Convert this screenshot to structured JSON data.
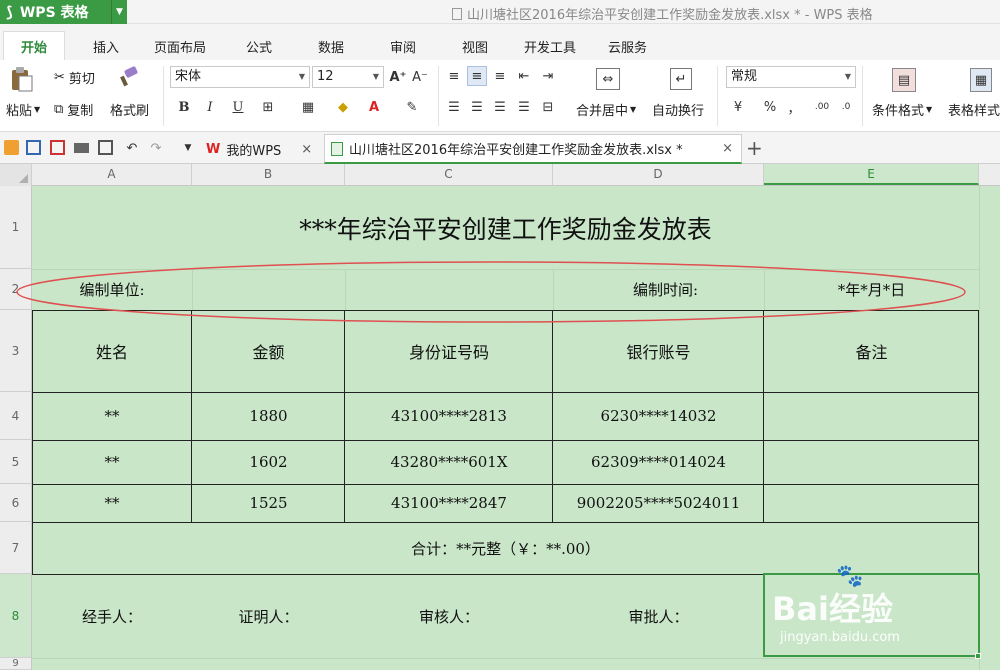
{
  "titlebar": {
    "app_button": "WPS 表格",
    "window_title": "山川塘社区2016年综治平安创建工作奖励金发放表.xlsx * - WPS 表格"
  },
  "menu_tabs": [
    "开始",
    "插入",
    "页面布局",
    "公式",
    "数据",
    "审阅",
    "视图",
    "开发工具",
    "云服务"
  ],
  "ribbon": {
    "paste": "粘贴",
    "cut": "剪切",
    "copy": "复制",
    "format_painter": "格式刷",
    "font_name": "宋体",
    "font_size": "12",
    "bold": "B",
    "italic": "I",
    "underline": "U",
    "merge_center": "合并居中",
    "wrap_text": "自动换行",
    "number_format": "常规",
    "percent": "%",
    "comma": "，",
    "cond_format": "条件格式",
    "table_style": "表格样式"
  },
  "doc_tabs": {
    "home_tab": "我的WPS",
    "file_tab": "山川塘社区2016年综治平安创建工作奖励金发放表.xlsx *"
  },
  "columns": [
    "A",
    "B",
    "C",
    "D",
    "E"
  ],
  "rows": [
    "1",
    "2",
    "3",
    "4",
    "5",
    "6",
    "7",
    "8",
    "9"
  ],
  "sheet": {
    "title": "***年综治平安创建工作奖励金发放表",
    "unit_label": "编制单位:",
    "time_label": "编制时间:",
    "time_value": "*年*月*日",
    "headers": [
      "姓名",
      "金额",
      "身份证号码",
      "银行账号",
      "备注"
    ],
    "records": [
      [
        "**",
        "1880",
        "43100****2813",
        "6230****14032",
        ""
      ],
      [
        "**",
        "1602",
        "43280****601X",
        "62309****014024",
        ""
      ],
      [
        "**",
        "1525",
        "43100****2847",
        "9002205****5024011",
        ""
      ]
    ],
    "total": "合计：**元整（￥：**.00）",
    "signatures": [
      "经手人：",
      "证明人：",
      "审核人：",
      "审批人："
    ]
  },
  "watermark": {
    "brand": "Bai经验",
    "url": "jingyan.baidu.com"
  },
  "colors": {
    "accent": "#3b9b45",
    "sheet_bg": "#c9e6c9",
    "ellipse": "#e05050"
  }
}
